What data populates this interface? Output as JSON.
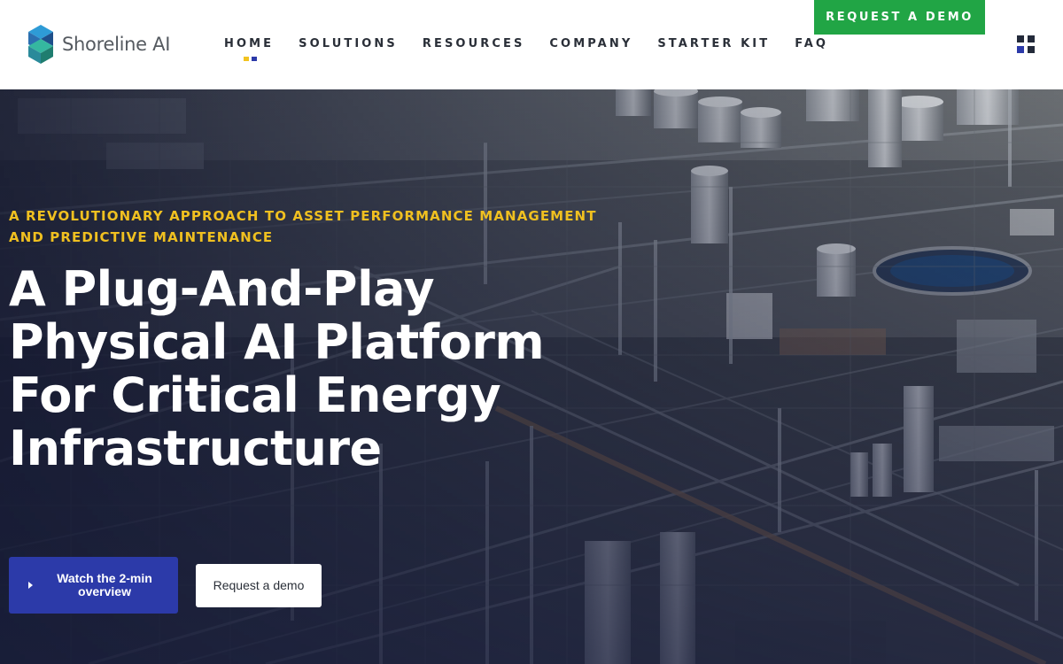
{
  "header": {
    "brand": "Shoreline AI",
    "nav": [
      {
        "label": "HOME",
        "active": true
      },
      {
        "label": "SOLUTIONS",
        "active": false
      },
      {
        "label": "RESOURCES",
        "active": false
      },
      {
        "label": "COMPANY",
        "active": false
      },
      {
        "label": "STARTER KIT",
        "active": false
      },
      {
        "label": "FAQ",
        "active": false
      }
    ],
    "cta_label": "REQUEST A DEMO",
    "menu_icon": "grid-icon"
  },
  "hero": {
    "kicker": "A REVOLUTIONARY APPROACH TO ASSET PERFORMANCE MANAGEMENT AND PREDICTIVE MAINTENANCE",
    "headline": "A Plug-And-Play Physical AI Platform For Critical Energy Infrastructure",
    "primary_button": "Watch the 2-min overview",
    "secondary_button": "Request a demo",
    "background": "industrial refinery aerial photo"
  },
  "colors": {
    "accent_green": "#21a545",
    "accent_blue": "#2c3aa9",
    "accent_yellow": "#f0c020",
    "text_dark": "#2a2f38"
  }
}
